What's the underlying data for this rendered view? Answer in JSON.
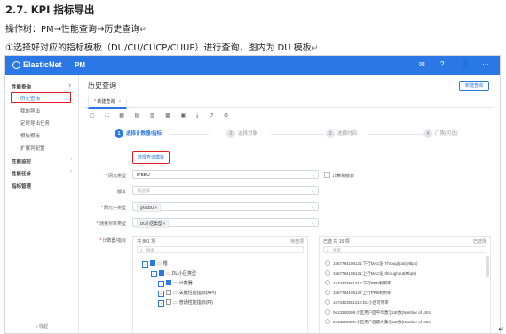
{
  "doc": {
    "heading": "2.7.   KPI 指标导出",
    "path": "操作树：PM→性能查询→历史查询",
    "step": "①选择好对应的指标模板（DU/CU/CUCP/CUUP）进行查询，图内为 DU 模板",
    "return_mark": "↵"
  },
  "app": {
    "logo": "ElasticNet",
    "module": "PM",
    "top_icons": [
      "✉",
      "?",
      "👤",
      "···"
    ]
  },
  "sidebar": {
    "items": [
      {
        "label": "性能查询",
        "type": "group",
        "chevron": "∨"
      },
      {
        "label": "历史查询",
        "type": "item",
        "active": true,
        "highlight": true
      },
      {
        "label": "我的导出",
        "type": "item"
      },
      {
        "label": "定时导出任务",
        "type": "item"
      },
      {
        "label": "模板模板",
        "type": "item"
      },
      {
        "label": "扩展列配置",
        "type": "item"
      },
      {
        "label": "性能监控",
        "type": "group",
        "chevron": "‹"
      },
      {
        "label": "性能任务",
        "type": "group",
        "chevron": "‹"
      },
      {
        "label": "指标管理",
        "type": "group"
      }
    ],
    "collapse_label": "« 收起"
  },
  "main": {
    "title": "历史查询",
    "new_button": "新建查询",
    "tab": {
      "star": "*",
      "label": "新建查询",
      "close": "×"
    },
    "toolbar_icons": "▢ ⛶ ▦ ▤ ▥ ▩ ▣ ⤓ ↺ ⚙",
    "steps": [
      {
        "num": "1",
        "label": "选择计数器/指标",
        "active": true
      },
      {
        "num": "2",
        "label": "选择对象"
      },
      {
        "num": "3",
        "label": "选择时间"
      },
      {
        "num": "4",
        "label": "门限(可选)"
      }
    ],
    "select_template_button": "选择查询模板",
    "form": {
      "network_type_label": "网元类型",
      "network_type_value": "ITBBU",
      "show_unified_label": "计算和搬表",
      "version_label": "版本",
      "version_placeholder": "请选择",
      "ne_type_label": "网元子类型",
      "ne_type_value": "gNBDU",
      "object_type_label": "测量对象类型",
      "object_type_value": "DU小区类型",
      "counter_label": "计数器/指标"
    },
    "left_panel": {
      "header": "共 801 项",
      "header_right": "待选项",
      "search_placeholder": "搜索",
      "tree": [
        {
          "label": "根",
          "indent": 0,
          "toggle": "⊟",
          "checked": true
        },
        {
          "label": "DU小区类型",
          "indent": 1,
          "toggle": "⊟",
          "checked": true
        },
        {
          "label": "计数器",
          "indent": 2,
          "toggle": "⊞",
          "checked": true
        },
        {
          "label": "关键性能指标(KPI)",
          "indent": 2,
          "toggle": "⊞",
          "checked": false
        },
        {
          "label": "普通性能指标(PI)",
          "indent": 2,
          "toggle": "⊞",
          "checked": false
        }
      ]
    },
    "right_panel": {
      "header": "已选  共 15 项",
      "header_right": "已选择",
      "search_placeholder": "搜索",
      "items": [
        "1567794198121:下行MAC层 Throughput(Mbps)",
        "1567794198121:上行MAC层 throughput(Mbps)",
        "1573423561310:下行PRB利用率",
        "1567794198122:上行PRB利用率",
        "1573423561310:DU小区可用率",
        "0613250009:小区用户面平均激活UE数(Number of UEs)",
        "0613250009:小区用户面最大激活UE数(Number of UEs)"
      ]
    }
  }
}
